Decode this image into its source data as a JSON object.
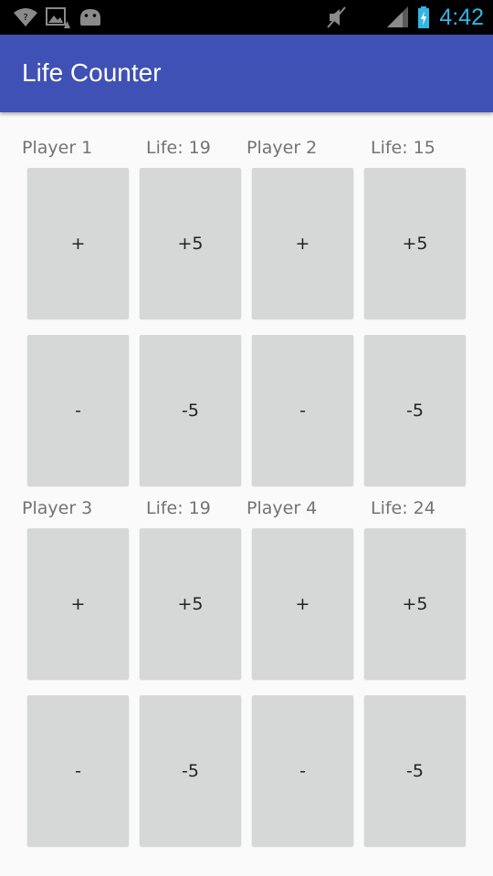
{
  "status_bar": {
    "time": "4:42",
    "icons": [
      "wifi-question-icon",
      "image-warning-icon",
      "android-icon",
      "mute-icon",
      "signal-icon",
      "battery-charging-icon"
    ]
  },
  "app_bar": {
    "title": "Life Counter",
    "color": "#3f51b5"
  },
  "players": [
    {
      "name": "Player 1",
      "life_text": "Life: 19",
      "life": 19,
      "buttons": {
        "plus": "+",
        "plus5": "+5",
        "minus": "-",
        "minus5": "-5"
      }
    },
    {
      "name": "Player 2",
      "life_text": "Life: 15",
      "life": 15,
      "buttons": {
        "plus": "+",
        "plus5": "+5",
        "minus": "-",
        "minus5": "-5"
      }
    },
    {
      "name": "Player 3",
      "life_text": "Life: 19",
      "life": 19,
      "buttons": {
        "plus": "+",
        "plus5": "+5",
        "minus": "-",
        "minus5": "-5"
      }
    },
    {
      "name": "Player 4",
      "life_text": "Life: 24",
      "life": 24,
      "buttons": {
        "plus": "+",
        "plus5": "+5",
        "minus": "-",
        "minus5": "-5"
      }
    }
  ]
}
